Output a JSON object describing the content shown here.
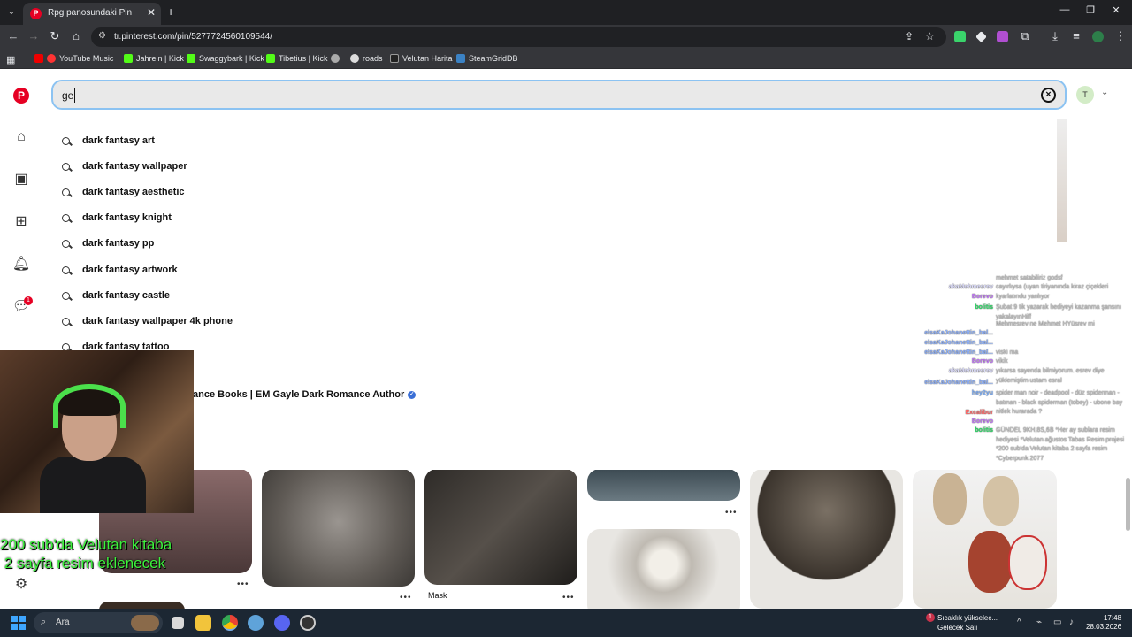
{
  "browser": {
    "tab_title": "Rpg panosundaki Pin",
    "url": "tr.pinterest.com/pin/5277724560109544/",
    "bookmarks": [
      "YouTube Music",
      "Jahrein | Kick",
      "Swaggybark | Kick",
      "Tibetius | Kick",
      "roads",
      "Velutan Harita",
      "SteamGridDB"
    ]
  },
  "search": {
    "value": "ge",
    "avatar_initial": "T"
  },
  "suggestions": [
    "dark fantasy art",
    "dark fantasy wallpaper",
    "dark fantasy aesthetic",
    "dark fantasy knight",
    "dark fantasy pp",
    "dark fantasy artwork",
    "dark fantasy castle",
    "dark fantasy wallpaper 4k phone",
    "dark fantasy tattoo"
  ],
  "board_result": "ance Books | EM Gayle Dark Romance Author",
  "nav": {
    "message_badge": "1"
  },
  "pins": {
    "mask_title": "Mask"
  },
  "stream_overlay": {
    "line1": "200 sub'da Velutan kitaba",
    "line2": " 2 sayfa resim eklenecek"
  },
  "chat": [
    {
      "name": "",
      "msg": "mehmet satabiliriz godsf",
      "color": "#ff5fa0"
    },
    {
      "name": "akaMehmesrev",
      "msg": "cayırlıysa (uyan tiriyanında kiraz çiçekleri",
      "color": "#e0e0ff"
    },
    {
      "name": "Borevo",
      "msg": "kyarlatındu yanlıyor",
      "color": "#c678ff"
    },
    {
      "name": "bolitis",
      "msg": "Şubat 9 tik yazarak hediyeyi kazanma şansını yakalayınHiff",
      "color": "#2ee06a"
    },
    {
      "name": "",
      "msg": "Mehmesrev ne Mehmet HYüsrev mi",
      "color": "#aaaaff"
    },
    {
      "name": "elsaKaJohanettin_bal...",
      "msg": "",
      "color": "#8fb3ff"
    },
    {
      "name": "elsaKaJohanettin_bal...",
      "msg": "",
      "color": "#8fb3ff"
    },
    {
      "name": "elsaKaJohanettin_bal...",
      "msg": "viski ma",
      "color": "#8fb3ff"
    },
    {
      "name": "Borevo",
      "msg": "vikik",
      "color": "#c678ff"
    },
    {
      "name": "akaMehmesrev",
      "msg": "yıkarsa sayenda bilmiyorum. esrev diye yüklemiştim ustam esral",
      "color": "#e0e0ff"
    },
    {
      "name": "elsaKaJohanettin_bal...",
      "msg": "",
      "color": "#8fb3ff"
    },
    {
      "name": "hey2yu",
      "msg": "spider man noir - deadpool - düz spiderman - batman - black spiderman (tobey) - ubone bay nitlek hurarada ?",
      "color": "#7fb2ff"
    },
    {
      "name": "Excalibur",
      "msg": "",
      "color": "#ff6a6a"
    },
    {
      "name": "Borevo",
      "msg": "",
      "color": "#c678ff"
    },
    {
      "name": "bolitis",
      "msg": "GÜNDEL 9KH,8S,6B *Her ay sublara resim hediyesi *Velutan ağustos Tabas Resim projesi *200 sub'da Velutan kitaba 2 sayfa resim *Cyberpunk 2077",
      "color": "#2ee06a"
    }
  ],
  "taskbar": {
    "search_placeholder": "Ara",
    "weather_line1": "Sıcaklık yükselec...",
    "weather_line2": "Gelecek Salı",
    "time": "17:48",
    "date": "28.03.2026",
    "notif_badge": "1"
  }
}
